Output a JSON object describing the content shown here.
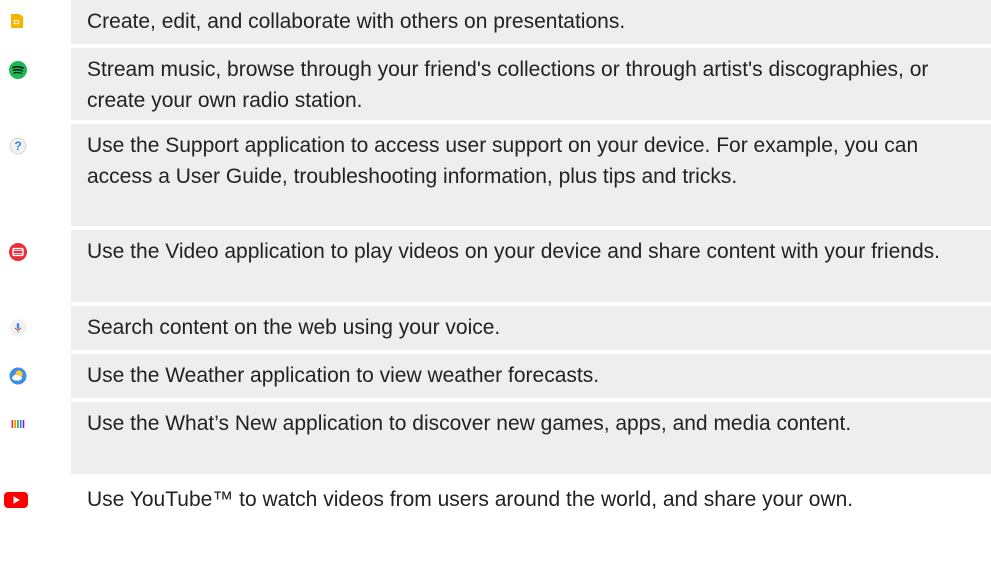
{
  "apps": [
    {
      "icon": "slides-icon",
      "description": "Create, edit, and collaborate with others on presentations."
    },
    {
      "icon": "spotify-icon",
      "description": "Stream music, browse through your friend's collections or through artist's discographies, or create your own radio station."
    },
    {
      "icon": "support-icon",
      "description": "Use the Support application to access user support on your device. For example, you can access a User Guide, troubleshooting information, plus tips and tricks."
    },
    {
      "icon": "video-icon",
      "description": "Use the Video application to play videos on your device and share content with your friends."
    },
    {
      "icon": "voice-search-icon",
      "description": "Search content on the web using your voice."
    },
    {
      "icon": "weather-icon",
      "description": "Use the Weather application to view weather forecasts."
    },
    {
      "icon": "whats-new-icon",
      "description": "Use the What’s New application to discover new games, apps, and media content."
    },
    {
      "icon": "youtube-icon",
      "description": "Use YouTube™ to watch videos from users around the world, and share your own."
    }
  ]
}
